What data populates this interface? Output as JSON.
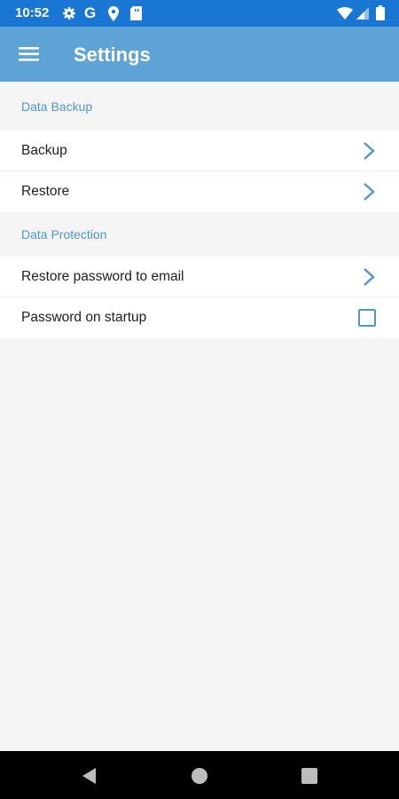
{
  "status_bar": {
    "time": "10:52",
    "icons": [
      "settings-icon",
      "google-icon",
      "location-icon",
      "sim-icon",
      "wifi-icon",
      "signal-icon",
      "battery-icon"
    ],
    "google_glyph": "G"
  },
  "app_bar": {
    "title": "Settings",
    "menu_icon": "hamburger-menu-icon",
    "color": "#5ea3d6"
  },
  "sections": [
    {
      "header": "Data Backup",
      "items": [
        {
          "label": "Backup",
          "control": "chevron"
        },
        {
          "label": "Restore",
          "control": "chevron"
        }
      ]
    },
    {
      "header": "Data Protection",
      "items": [
        {
          "label": "Restore password to email",
          "control": "chevron"
        },
        {
          "label": "Password on startup",
          "control": "checkbox",
          "checked": false
        }
      ]
    }
  ],
  "nav_bar": {
    "buttons": [
      "back-icon",
      "home-icon",
      "recents-icon"
    ]
  },
  "colors": {
    "status_bar": "#1976d2",
    "accent": "#4f96d1",
    "background": "#f5f5f5"
  }
}
